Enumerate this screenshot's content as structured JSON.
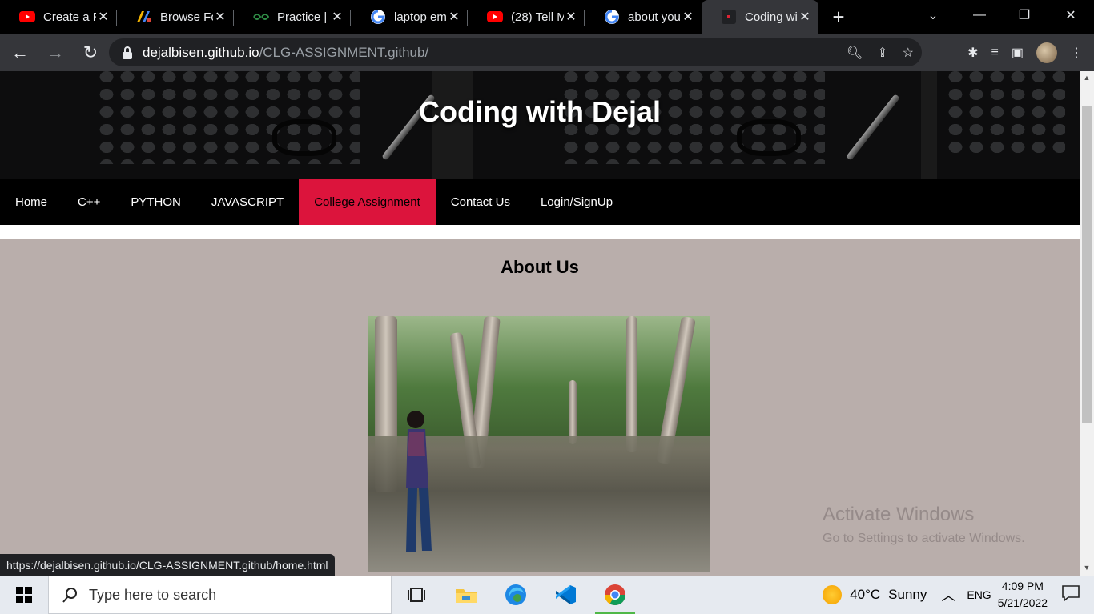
{
  "browser": {
    "tabs": [
      {
        "title": "Create a R",
        "icon": "youtube-icon"
      },
      {
        "title": "Browse Fo",
        "icon": "browse-icon"
      },
      {
        "title": "Practice | G",
        "icon": "geeksforgeeks-icon"
      },
      {
        "title": "laptop em",
        "icon": "google-icon"
      },
      {
        "title": "(28) Tell M",
        "icon": "youtube-icon"
      },
      {
        "title": "about you",
        "icon": "google-icon"
      },
      {
        "title": "Coding wi",
        "icon": "site-icon",
        "active": true
      }
    ],
    "url_host": "dejalbisen.github.io",
    "url_path": "/CLG-ASSIGNMENT.github/",
    "status_url": "https://dejalbisen.github.io/CLG-ASSIGNMENT.github/home.html"
  },
  "site": {
    "title": "Coding with Dejal",
    "nav": [
      "Home",
      "C++",
      "PYTHON",
      "JAVASCRIPT",
      "College Assignment",
      "Contact Us",
      "Login/SignUp"
    ],
    "active_nav": "College Assignment",
    "about_heading": "About Us"
  },
  "watermark": {
    "line1": "Activate Windows",
    "line2": "Go to Settings to activate Windows."
  },
  "taskbar": {
    "search_placeholder": "Type here to search",
    "weather_temp": "40°C",
    "weather_text": "Sunny",
    "language": "ENG",
    "time": "4:09 PM",
    "date": "5/21/2022"
  },
  "colors": {
    "accent_nav": "#dc143c",
    "page_bg": "#b9aeab"
  }
}
